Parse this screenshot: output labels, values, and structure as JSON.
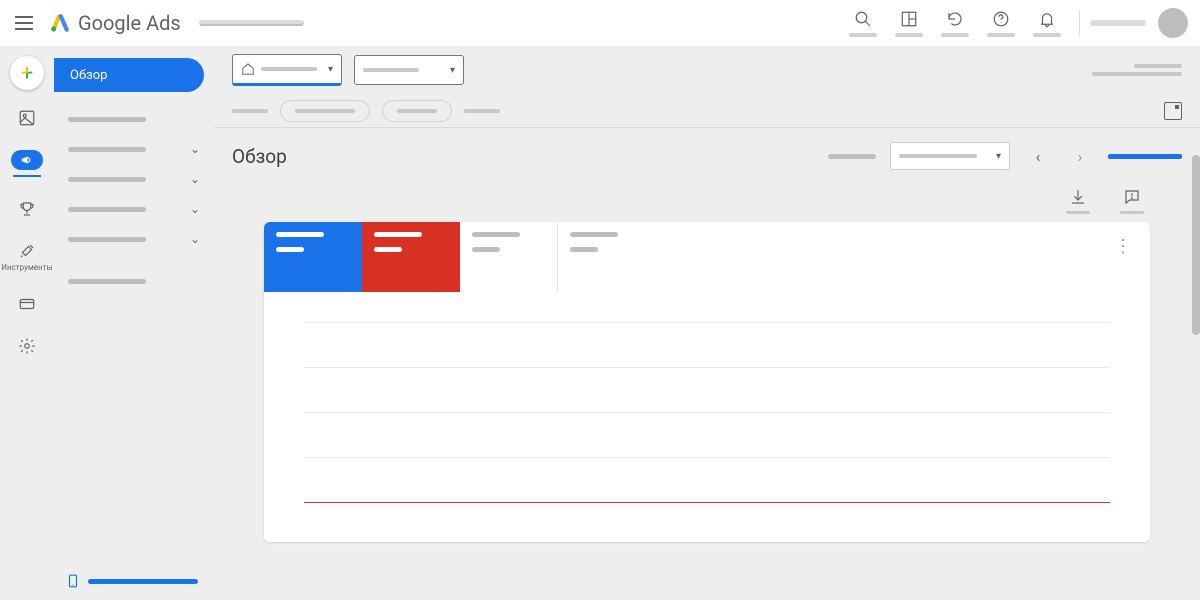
{
  "header": {
    "brand_prefix": "Google",
    "brand_suffix": "Ads"
  },
  "top_icons": {
    "search": "search-icon",
    "reports": "reports-icon",
    "refresh": "refresh-icon",
    "help": "help-icon",
    "notifications": "bell-icon"
  },
  "rail": {
    "tools_label": "Инструменты"
  },
  "nav": {
    "active_label": "Обзор",
    "items": [
      {
        "expandable": false
      },
      {
        "expandable": true
      },
      {
        "expandable": true
      },
      {
        "expandable": true
      },
      {
        "expandable": true
      },
      {
        "expandable": false
      }
    ]
  },
  "page": {
    "title": "Обзор"
  },
  "metrics": [
    {
      "variant": "blue"
    },
    {
      "variant": "red"
    },
    {
      "variant": "plain"
    },
    {
      "variant": "plain"
    }
  ],
  "chart_data": {
    "type": "line",
    "title": "",
    "xlabel": "",
    "ylabel": "",
    "series": [
      {
        "name": "metric-blue",
        "values": []
      },
      {
        "name": "metric-red",
        "values": [
          0,
          0,
          0,
          0,
          0,
          0,
          0
        ]
      }
    ],
    "gridlines": 5,
    "note": "Chart shows flat zero red series along bottom gridline; blue series not drawn; x-axis labels redacted in source."
  }
}
